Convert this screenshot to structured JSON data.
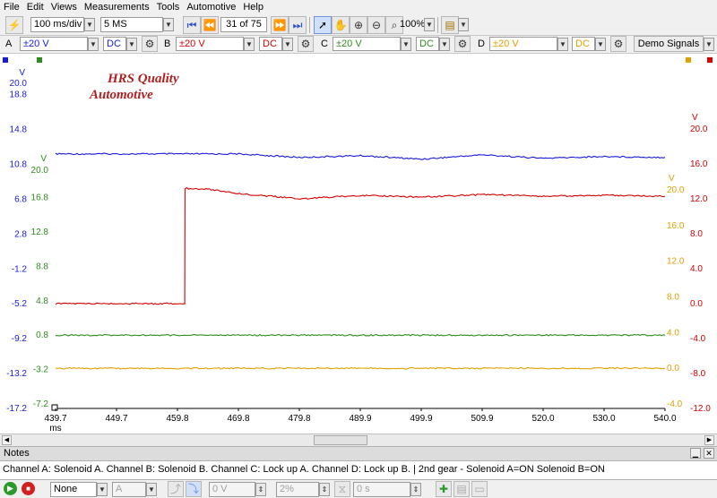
{
  "menu": [
    "File",
    "Edit",
    "Views",
    "Measurements",
    "Tools",
    "Automotive",
    "Help"
  ],
  "toolbar": {
    "timebase": "100 ms/div",
    "samples": "5 MS",
    "buffer": "31 of 75",
    "zoom": "100%"
  },
  "channels": [
    {
      "letter": "A",
      "range": "±20 V",
      "coupling": "DC",
      "color": "#d40000"
    },
    {
      "letter": "B",
      "range": "±20 V",
      "coupling": "DC",
      "color": "#d40000"
    },
    {
      "letter": "C",
      "range": "±20 V",
      "coupling": "DC",
      "color": "#2e8b1e"
    },
    {
      "letter": "D",
      "range": "±20 V",
      "coupling": "DC",
      "color": "#e0a000"
    }
  ],
  "demo_signals": "Demo Signals",
  "watermark": {
    "line1": "HRS Quality",
    "line2": "Automotive"
  },
  "notes": {
    "title": "Notes",
    "text": "Channel A: Solenoid A.   Channel B: Solenoid B.   Channel C: Lock up A.   Channel D: Lock up B.     |   2nd gear - Solenoid A=ON   Solenoid B=ON"
  },
  "statusbar": {
    "trigger_mode": "None",
    "trigger_channel": "A",
    "threshold": "0 V",
    "pre_trigger": "2%",
    "delay": "0 s"
  },
  "chart_data": {
    "type": "line",
    "xlabel": "ms",
    "x_ticks": [
      "439.7",
      "449.7",
      "459.8",
      "469.8",
      "479.8",
      "489.9",
      "499.9",
      "509.9",
      "520.0",
      "530.0",
      "540.0"
    ],
    "xlim": [
      439.7,
      540.0
    ],
    "axes": [
      {
        "id": "blue",
        "unit": "V",
        "side": "left",
        "color": "#1a1adc",
        "range": [
          -17.2,
          20.0
        ],
        "ticks": [
          "20.0",
          "18.8",
          "14.8",
          "10.8",
          "6.8",
          "2.8",
          "-1.2",
          "-5.2",
          "-9.2",
          "-13.2",
          "-17.2"
        ]
      },
      {
        "id": "green",
        "unit": "V",
        "side": "left",
        "color": "#2e8b1e",
        "range": [
          -7.2,
          20.0
        ],
        "ticks": [
          "20.0",
          "16.8",
          "12.8",
          "8.8",
          "4.8",
          "0.8",
          "-3.2",
          "-7.2"
        ]
      },
      {
        "id": "red",
        "unit": "V",
        "side": "right",
        "color": "#d40000",
        "range": [
          -12.0,
          20.0
        ],
        "ticks": [
          "20.0",
          "16.0",
          "12.0",
          "8.0",
          "4.0",
          "0.0",
          "-4.0",
          "-8.0",
          "-12.0"
        ]
      },
      {
        "id": "orange",
        "unit": "V",
        "side": "right",
        "color": "#e0a000",
        "range": [
          -4.0,
          20.0
        ],
        "ticks": [
          "20.0",
          "16.0",
          "12.0",
          "8.0",
          "4.0",
          "0.0",
          "-4.0"
        ]
      }
    ],
    "series": [
      {
        "axis": "blue",
        "color": "#1a1adc",
        "x": [
          439.7,
          449.7,
          459.8,
          469.8,
          479.8,
          489.9,
          499.9,
          509.9,
          520.0,
          530.0,
          540.0
        ],
        "y": [
          12.0,
          12.0,
          12.0,
          12.0,
          11.6,
          11.8,
          11.4,
          11.9,
          11.5,
          11.7,
          11.6
        ]
      },
      {
        "axis": "red",
        "color": "#d40000",
        "x": [
          439.7,
          450.0,
          459.0,
          460.9,
          461.0,
          465.0,
          470.0,
          480.0,
          490.0,
          500.0,
          510.0,
          520.0,
          530.0,
          540.0
        ],
        "y": [
          0.0,
          0.0,
          0.0,
          0.0,
          13.2,
          13.1,
          12.6,
          12.0,
          12.4,
          12.2,
          12.5,
          12.3,
          12.4,
          12.3
        ]
      },
      {
        "axis": "green",
        "color": "#2e8b1e",
        "x": [
          439.7,
          540.0
        ],
        "y": [
          0.8,
          0.8
        ]
      },
      {
        "axis": "orange",
        "color": "#e0a000",
        "x": [
          439.7,
          540.0
        ],
        "y": [
          0.0,
          0.0
        ]
      }
    ],
    "grid": false
  }
}
